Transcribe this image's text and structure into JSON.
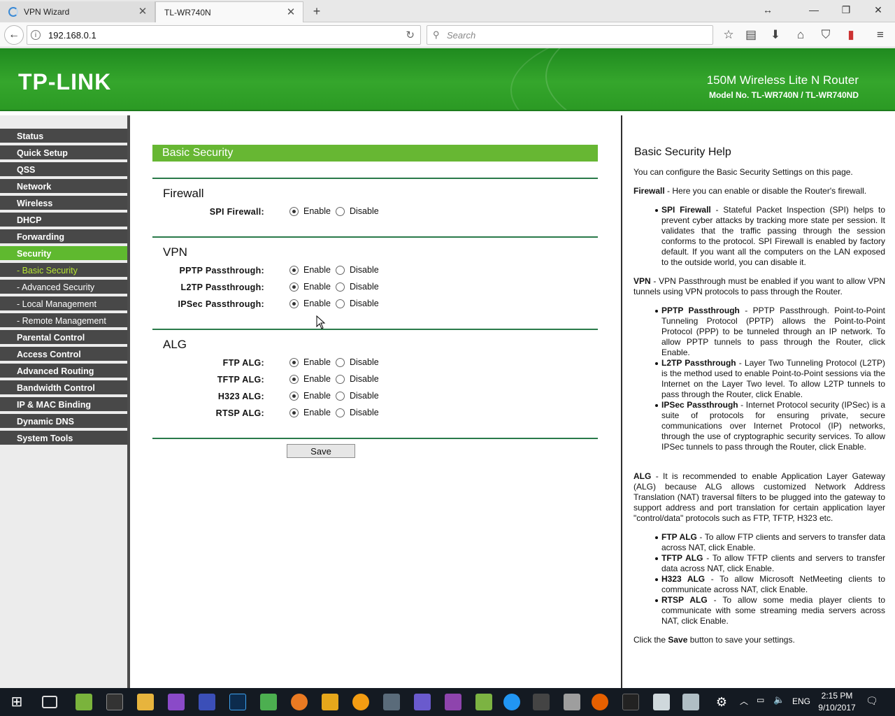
{
  "browser": {
    "tabs": [
      {
        "label": "VPN Wizard",
        "active": false
      },
      {
        "label": "TL-WR740N",
        "active": true
      }
    ],
    "url": "192.168.0.1",
    "search_placeholder": "Search"
  },
  "header": {
    "logo": "TP-LINK",
    "product": "150M Wireless Lite N Router",
    "model": "Model No. TL-WR740N / TL-WR740ND"
  },
  "sidebar": {
    "items": [
      {
        "label": "Status"
      },
      {
        "label": "Quick Setup"
      },
      {
        "label": "QSS"
      },
      {
        "label": "Network"
      },
      {
        "label": "Wireless"
      },
      {
        "label": "DHCP"
      },
      {
        "label": "Forwarding"
      },
      {
        "label": "Security",
        "selected": true
      },
      {
        "label": "- Basic Security",
        "sub": true,
        "current": true
      },
      {
        "label": "- Advanced Security",
        "sub": true
      },
      {
        "label": "- Local Management",
        "sub": true
      },
      {
        "label": "- Remote Management",
        "sub": true
      },
      {
        "label": "Parental Control"
      },
      {
        "label": "Access Control"
      },
      {
        "label": "Advanced Routing"
      },
      {
        "label": "Bandwidth Control"
      },
      {
        "label": "IP & MAC Binding"
      },
      {
        "label": "Dynamic DNS"
      },
      {
        "label": "System Tools"
      }
    ]
  },
  "main": {
    "section_title": "Basic Security",
    "enable_label": "Enable",
    "disable_label": "Disable",
    "firewall": {
      "title": "Firewall",
      "rows": [
        {
          "label": "SPI Firewall:",
          "value": "Enable"
        }
      ]
    },
    "vpn": {
      "title": "VPN",
      "rows": [
        {
          "label": "PPTP Passthrough:",
          "value": "Enable"
        },
        {
          "label": "L2TP Passthrough:",
          "value": "Enable"
        },
        {
          "label": "IPSec Passthrough:",
          "value": "Enable"
        }
      ]
    },
    "alg": {
      "title": "ALG",
      "rows": [
        {
          "label": "FTP ALG:",
          "value": "Enable"
        },
        {
          "label": "TFTP ALG:",
          "value": "Enable"
        },
        {
          "label": "H323 ALG:",
          "value": "Enable"
        },
        {
          "label": "RTSP ALG:",
          "value": "Enable"
        }
      ]
    },
    "save_label": "Save"
  },
  "help": {
    "title": "Basic Security Help",
    "intro": "You can configure the Basic Security Settings on this page.",
    "firewall_term": "Firewall",
    "firewall_text": " - Here you can enable or disable the Router's firewall.",
    "spi_term": "SPI Firewall",
    "spi_text": " - Stateful Packet Inspection (SPI) helps to prevent cyber attacks by tracking more state per session. It validates that the traffic passing through the session conforms to the protocol. SPI Firewall is enabled by factory default. If you want all the computers on the LAN exposed to the outside world, you can disable it.",
    "vpn_term": "VPN",
    "vpn_text": " - VPN Passthrough must be enabled if you want to allow VPN tunnels using VPN protocols to pass through the Router.",
    "pptp_term": "PPTP Passthrough",
    "pptp_text": " - PPTP Passthrough. Point-to-Point Tunneling Protocol (PPTP) allows the Point-to-Point Protocol (PPP) to be tunneled through an IP network. To allow PPTP tunnels to pass through the Router, click Enable.",
    "l2tp_term": "L2TP Passthrough",
    "l2tp_text": " - Layer Two Tunneling Protocol (L2TP) is the method used to enable Point-to-Point sessions via the Internet on the Layer Two level. To allow L2TP tunnels to pass through the Router, click Enable.",
    "ipsec_term": "IPSec Passthrough",
    "ipsec_text": " - Internet Protocol security (IPSec) is a suite of protocols for ensuring private, secure communications over Internet Protocol (IP) networks, through the use of cryptographic security services. To allow IPSec tunnels to pass through the Router, click Enable.",
    "alg_term": "ALG",
    "alg_text": " - It is recommended to enable Application Layer Gateway (ALG) because ALG allows customized Network Address Translation (NAT) traversal filters to be plugged into the gateway to support address and port translation for certain application layer \"control/data\" protocols such as FTP, TFTP, H323 etc.",
    "ftp_term": "FTP ALG",
    "ftp_text": " - To allow FTP clients and servers to transfer data across NAT, click Enable.",
    "tftp_term": "TFTP ALG",
    "tftp_text": " - To allow TFTP clients and servers to transfer data across NAT, click Enable.",
    "h323_term": "H323 ALG",
    "h323_text": " - To allow Microsoft NetMeeting clients to communicate across NAT, click Enable.",
    "rtsp_term": "RTSP ALG",
    "rtsp_text": " - To allow some media player clients to communicate with some streaming media servers across NAT, click Enable.",
    "save_pre": "Click the ",
    "save_term": "Save",
    "save_post": " button to save your settings."
  },
  "taskbar": {
    "language": "ENG",
    "time": "2:15 PM",
    "date": "9/10/2017"
  },
  "colors": {
    "header_green": "#2b9a24",
    "section_green": "#67b733",
    "menu_dark": "#484848",
    "menu_selected": "#5fb92f"
  }
}
